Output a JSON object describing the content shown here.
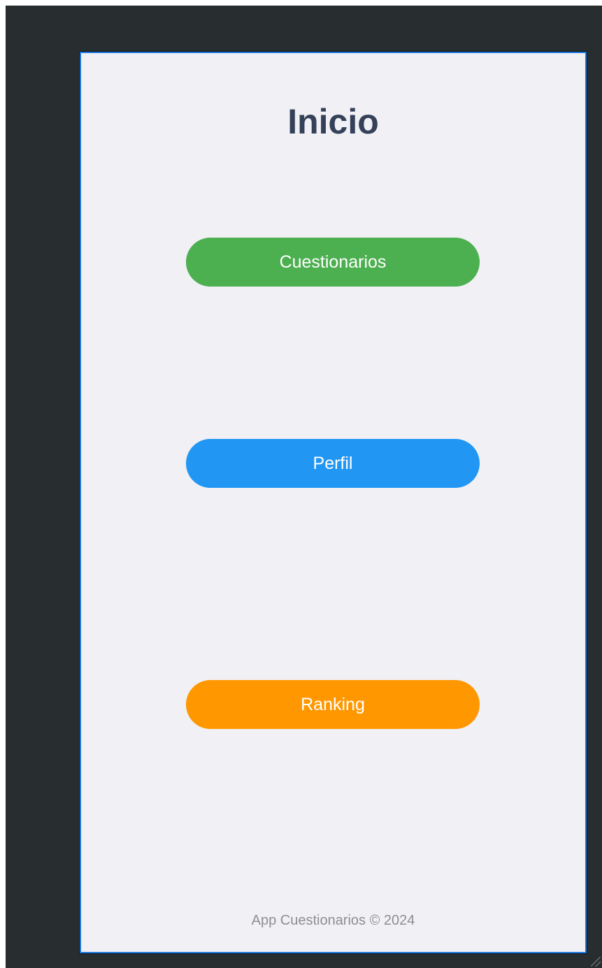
{
  "screen": {
    "title": "Inicio",
    "buttons": {
      "cuestionarios": "Cuestionarios",
      "perfil": "Perfil",
      "ranking": "Ranking"
    },
    "footer": "App Cuestionarios © 2024"
  },
  "colors": {
    "background": "#282e2f",
    "screen_background": "#f0f0f5",
    "title": "#354159",
    "cuestionarios": "#4caf50",
    "perfil": "#2196f3",
    "ranking": "#ff9800",
    "footer": "#8e8e93"
  }
}
